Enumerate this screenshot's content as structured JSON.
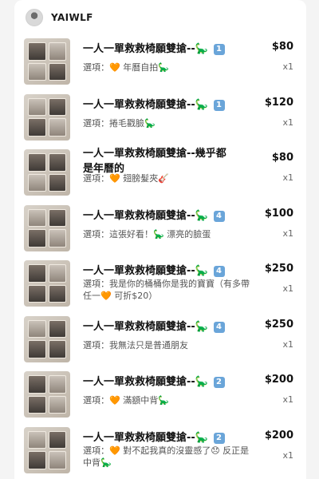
{
  "seller": {
    "name": "YAIWLF"
  },
  "items": [
    {
      "title": "一人一單救救椅願雙搶--",
      "badge": "1",
      "option_label": "選項：",
      "option_text": "年曆自拍",
      "price": "$80",
      "qty": "x1"
    },
    {
      "title": "一人一單救救椅願雙搶--",
      "badge": "1",
      "option_label": "選項：",
      "option_text": "捲毛戳臉",
      "price": "$120",
      "qty": "x1"
    },
    {
      "title": "一人一單救救椅願雙搶--幾乎都是年曆的",
      "badge": "",
      "option_label": "選項：",
      "option_text": "翅膀髮夾",
      "price": "$80",
      "qty": "x1"
    },
    {
      "title": "一人一單救救椅願雙搶--",
      "badge": "4",
      "option_label": "選項：",
      "option_text": "這張好看！",
      "option_text2": "漂亮的臉蛋",
      "price": "$100",
      "qty": "x1"
    },
    {
      "title": "一人一單救救椅願雙搶--",
      "badge": "4",
      "option_label": "選項：",
      "option_text": "我是你的桶桶你是我的寶寶（有多帶任一",
      "option_text2": "可折$20）",
      "price": "$250",
      "qty": "x1"
    },
    {
      "title": "一人一單救救椅願雙搶--",
      "badge": "4",
      "option_label": "選項：",
      "option_text": "我無法只是普通朋友",
      "price": "$250",
      "qty": "x1"
    },
    {
      "title": "一人一單救救椅願雙搶--",
      "badge": "2",
      "option_label": "選項：",
      "option_text": "滿額中背",
      "price": "$200",
      "qty": "x1"
    },
    {
      "title": "一人一單救救椅願雙搶--",
      "badge": "2",
      "option_label": "選項：",
      "option_text": "對不起我真的沒靈感了",
      "option_text2": "反正是中背",
      "price": "$200",
      "qty": "x1"
    }
  ],
  "icons": {
    "dino": "dinosaur-icon",
    "heart": "orange-heart-icon",
    "guitar": "guitar-icon",
    "sad_face": "disappointed-face-icon"
  },
  "colors": {
    "badge_bg": "#6aa5d9",
    "heart": "#e98a2c",
    "dino": "#2f6f8a"
  }
}
